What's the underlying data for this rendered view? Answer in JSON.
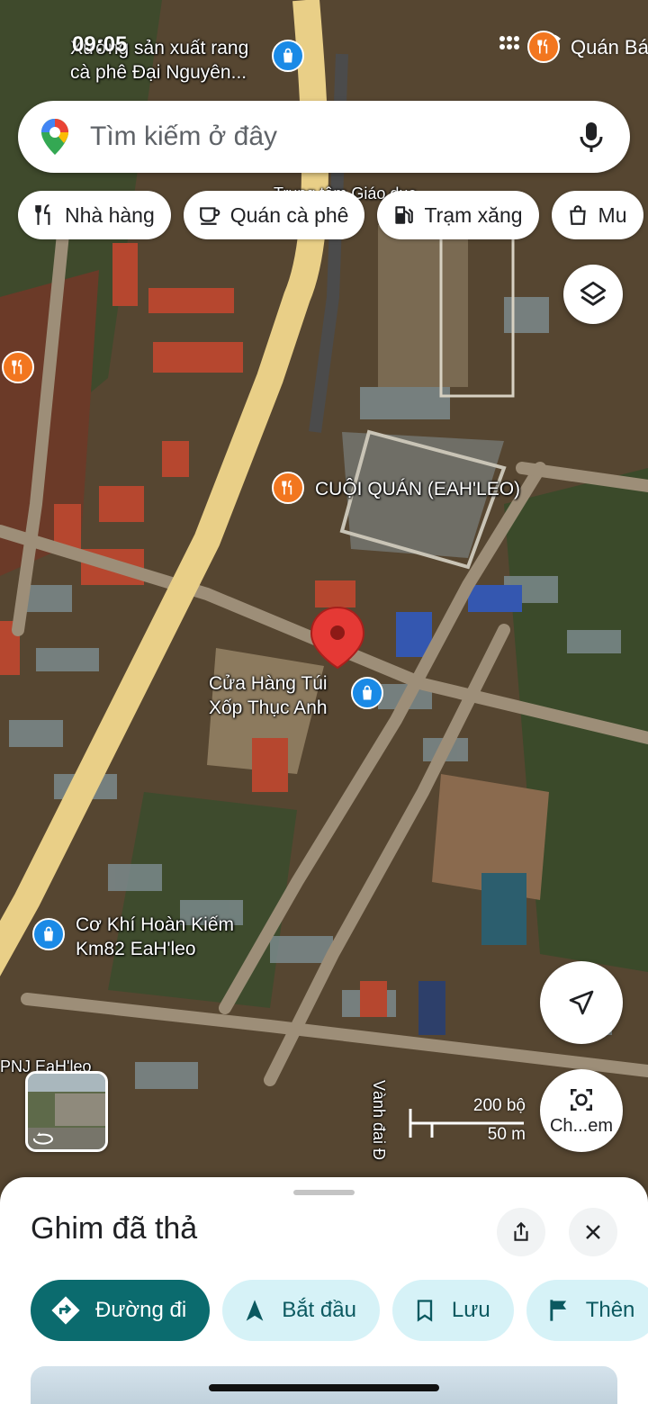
{
  "status_bar": {
    "time": "09:05",
    "notification_label": "Quán Bá"
  },
  "search": {
    "placeholder": "Tìm kiếm ở đây",
    "left_icon": "google-maps-pin-icon",
    "right_icon": "microphone-icon"
  },
  "chips": [
    {
      "label": "Nhà hàng",
      "icon": "fork-knife-icon"
    },
    {
      "label": "Quán cà phê",
      "icon": "coffee-cup-icon"
    },
    {
      "label": "Trạm xăng",
      "icon": "gas-pump-icon"
    },
    {
      "label": "Mu",
      "icon": "shopping-bag-icon"
    }
  ],
  "map": {
    "labels": {
      "top_poi": "Xưởng sản xuất rang\ncà phê Đại Nguyên...",
      "top_center": "Trung tâm Giáo dục",
      "cuoi_quan": "CUỘI QUÁN (EAH'LEO)",
      "cua_hang": "Cửa Hàng Túi\nXốp Thục Anh",
      "co_khi": "Cơ Khí Hoàn Kiếm\nKm82 EaH'leo",
      "pnj": "PNJ EaH'leo",
      "road": "Vành đai Đ"
    },
    "scale": {
      "top": "200 bộ",
      "bottom": "50 m"
    },
    "colors": {
      "pin": "#e53935",
      "food_poi": "#f2761f",
      "shop_poi": "#1a8ae6",
      "highway": "#e9cf87"
    }
  },
  "buttons": {
    "layers_icon": "layers-icon",
    "locate_icon": "navigation-arrow-icon",
    "lens_label": "Ch...em",
    "lens_icon": "camera-lens-icon"
  },
  "sheet": {
    "title": "Ghim đã thả",
    "share_icon": "share-icon",
    "close_icon": "close-icon",
    "actions": [
      {
        "label": "Đường đi",
        "icon": "directions-icon",
        "style": "primary"
      },
      {
        "label": "Bắt đầu",
        "icon": "navigation-arrow-icon",
        "style": "secondary"
      },
      {
        "label": "Lưu",
        "icon": "bookmark-icon",
        "style": "secondary"
      },
      {
        "label": "Thên",
        "icon": "flag-icon",
        "style": "secondary"
      }
    ]
  }
}
